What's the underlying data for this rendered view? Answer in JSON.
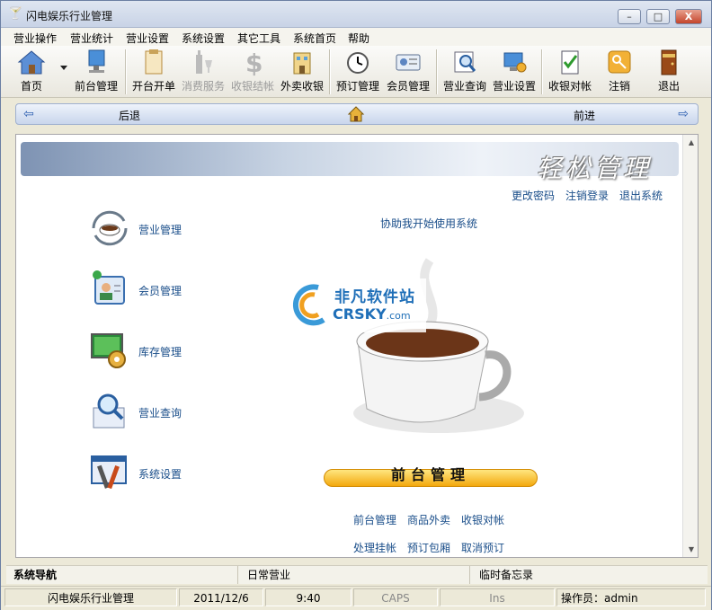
{
  "window": {
    "title": "闪电娱乐行业管理",
    "min": "–",
    "max": "□",
    "close": "X"
  },
  "menu": [
    "营业操作",
    "营业统计",
    "营业设置",
    "系统设置",
    "其它工具",
    "系统首页",
    "帮助"
  ],
  "toolbar": {
    "items": [
      {
        "label": "首页",
        "icon": "home-icon",
        "enabled": true
      },
      {
        "label": "前台管理",
        "icon": "monitor-icon",
        "enabled": true
      },
      {
        "label": "开台开单",
        "icon": "clipboard-icon",
        "enabled": true
      },
      {
        "label": "消费服务",
        "icon": "bottle-glass-icon",
        "enabled": false
      },
      {
        "label": "收银结帐",
        "icon": "dollar-icon",
        "enabled": false
      },
      {
        "label": "外卖收银",
        "icon": "building-icon",
        "enabled": true
      },
      {
        "label": "预订管理",
        "icon": "clock-icon",
        "enabled": true
      },
      {
        "label": "会员管理",
        "icon": "member-card-icon",
        "enabled": true
      },
      {
        "label": "营业查询",
        "icon": "search-doc-icon",
        "enabled": true
      },
      {
        "label": "营业设置",
        "icon": "settings-computer-icon",
        "enabled": true
      },
      {
        "label": "收银对帐",
        "icon": "checklist-icon",
        "enabled": true
      },
      {
        "label": "注销",
        "icon": "key-icon",
        "enabled": true
      },
      {
        "label": "退出",
        "icon": "door-icon",
        "enabled": true
      }
    ]
  },
  "nav": {
    "back": "后退",
    "forward": "前进"
  },
  "banner": {
    "title": "轻松管理"
  },
  "top_links": [
    "更改密码",
    "注销登录",
    "退出系统"
  ],
  "help_link": "协助我开始使用系统",
  "side_items": [
    {
      "label": "营业管理",
      "icon": "coffee-cup-icon"
    },
    {
      "label": "会员管理",
      "icon": "member-card-icon"
    },
    {
      "label": "库存管理",
      "icon": "inventory-icon"
    },
    {
      "label": "营业查询",
      "icon": "search-doc-icon"
    },
    {
      "label": "系统设置",
      "icon": "tools-icon"
    }
  ],
  "watermark": {
    "text": "非凡软件站",
    "sub": "CRSKY",
    "sub_suffix": ".com"
  },
  "center_caption": "前台管理",
  "bottom_links_row1": [
    "前台管理",
    "商品外卖",
    "收银对帐"
  ],
  "bottom_links_row2": [
    "处理挂帐",
    "预订包厢",
    "取消预订"
  ],
  "panels": [
    "系统导航",
    "日常营业",
    "临时备忘录"
  ],
  "status": {
    "app": "闪电娱乐行业管理",
    "date": "2011/12/6",
    "time": "9:40",
    "caps": "CAPS",
    "ins": "Ins",
    "operator": "操作员：admin"
  },
  "colors": {
    "link": "#1a4e8a",
    "caption_bar": "#f3a80d",
    "nav_arrow": "#2d5fb0"
  }
}
